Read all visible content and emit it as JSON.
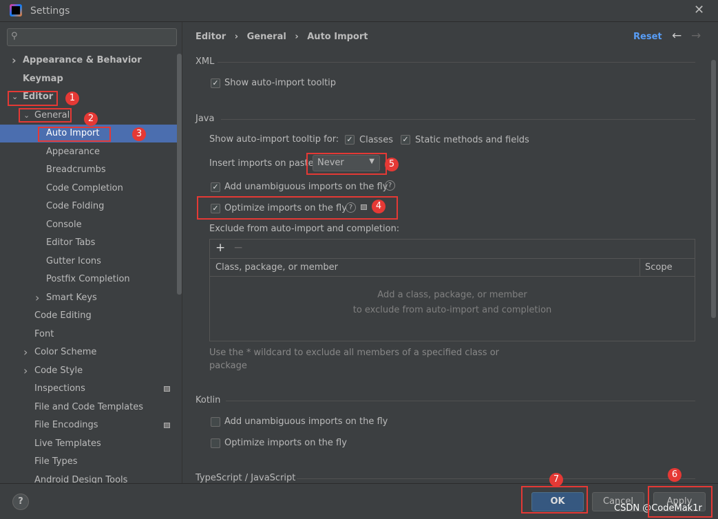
{
  "window": {
    "title": "Settings"
  },
  "search": {
    "placeholder": ""
  },
  "tree": [
    {
      "label": "Appearance & Behavior",
      "level": 0,
      "chevron": "right",
      "bold": true
    },
    {
      "label": "Keymap",
      "level": 0,
      "chevron": "",
      "bold": true
    },
    {
      "label": "Editor",
      "level": 0,
      "chevron": "down",
      "bold": true
    },
    {
      "label": "General",
      "level": 1,
      "chevron": "down"
    },
    {
      "label": "Auto Import",
      "level": 2,
      "chevron": "",
      "selected": true
    },
    {
      "label": "Appearance",
      "level": 2,
      "chevron": ""
    },
    {
      "label": "Breadcrumbs",
      "level": 2,
      "chevron": ""
    },
    {
      "label": "Code Completion",
      "level": 2,
      "chevron": ""
    },
    {
      "label": "Code Folding",
      "level": 2,
      "chevron": ""
    },
    {
      "label": "Console",
      "level": 2,
      "chevron": ""
    },
    {
      "label": "Editor Tabs",
      "level": 2,
      "chevron": ""
    },
    {
      "label": "Gutter Icons",
      "level": 2,
      "chevron": ""
    },
    {
      "label": "Postfix Completion",
      "level": 2,
      "chevron": ""
    },
    {
      "label": "Smart Keys",
      "level": 2,
      "chevron": "right"
    },
    {
      "label": "Code Editing",
      "level": 1,
      "chevron": ""
    },
    {
      "label": "Font",
      "level": 1,
      "chevron": ""
    },
    {
      "label": "Color Scheme",
      "level": 1,
      "chevron": "right"
    },
    {
      "label": "Code Style",
      "level": 1,
      "chevron": "right"
    },
    {
      "label": "Inspections",
      "level": 1,
      "chevron": "",
      "badge": true
    },
    {
      "label": "File and Code Templates",
      "level": 1,
      "chevron": ""
    },
    {
      "label": "File Encodings",
      "level": 1,
      "chevron": "",
      "badge": true
    },
    {
      "label": "Live Templates",
      "level": 1,
      "chevron": ""
    },
    {
      "label": "File Types",
      "level": 1,
      "chevron": ""
    },
    {
      "label": "Android Design Tools",
      "level": 1,
      "chevron": ""
    }
  ],
  "breadcrumb": {
    "parts": [
      "Editor",
      "General",
      "Auto Import"
    ],
    "sep": "›"
  },
  "header": {
    "reset": "Reset"
  },
  "xml": {
    "title": "XML",
    "show_tooltip": "Show auto-import tooltip",
    "show_tooltip_checked": true
  },
  "java": {
    "title": "Java",
    "tooltip_for": "Show auto-import tooltip for:",
    "classes": "Classes",
    "classes_checked": true,
    "static": "Static methods and fields",
    "static_checked": true,
    "insert_label": "Insert imports on paste:",
    "insert_value": "Never",
    "add_unambiguous": "Add unambiguous imports on the fly",
    "add_checked": true,
    "optimize": "Optimize imports on the fly",
    "optimize_checked": true,
    "exclude_label": "Exclude from auto-import and completion:",
    "col_member": "Class, package, or member",
    "col_scope": "Scope",
    "empty1": "Add a class, package, or member",
    "empty2": "to exclude from auto-import and completion",
    "hint1": "Use the * wildcard to exclude all members of a specified class or",
    "hint2": "package"
  },
  "kotlin": {
    "title": "Kotlin",
    "add_unambiguous": "Add unambiguous imports on the fly",
    "add_checked": false,
    "optimize": "Optimize imports on the fly",
    "optimize_checked": false
  },
  "ts": {
    "title": "TypeScript / JavaScript"
  },
  "footer": {
    "help": "?",
    "ok": "OK",
    "cancel": "Cancel",
    "apply": "Apply",
    "watermark": "CSDN @CodeMak1r"
  },
  "annotations": [
    "1",
    "2",
    "3",
    "4",
    "5",
    "6",
    "7"
  ],
  "colors": {
    "selection": "#4b6eaf",
    "annotation": "#e53935",
    "link": "#589df6"
  }
}
